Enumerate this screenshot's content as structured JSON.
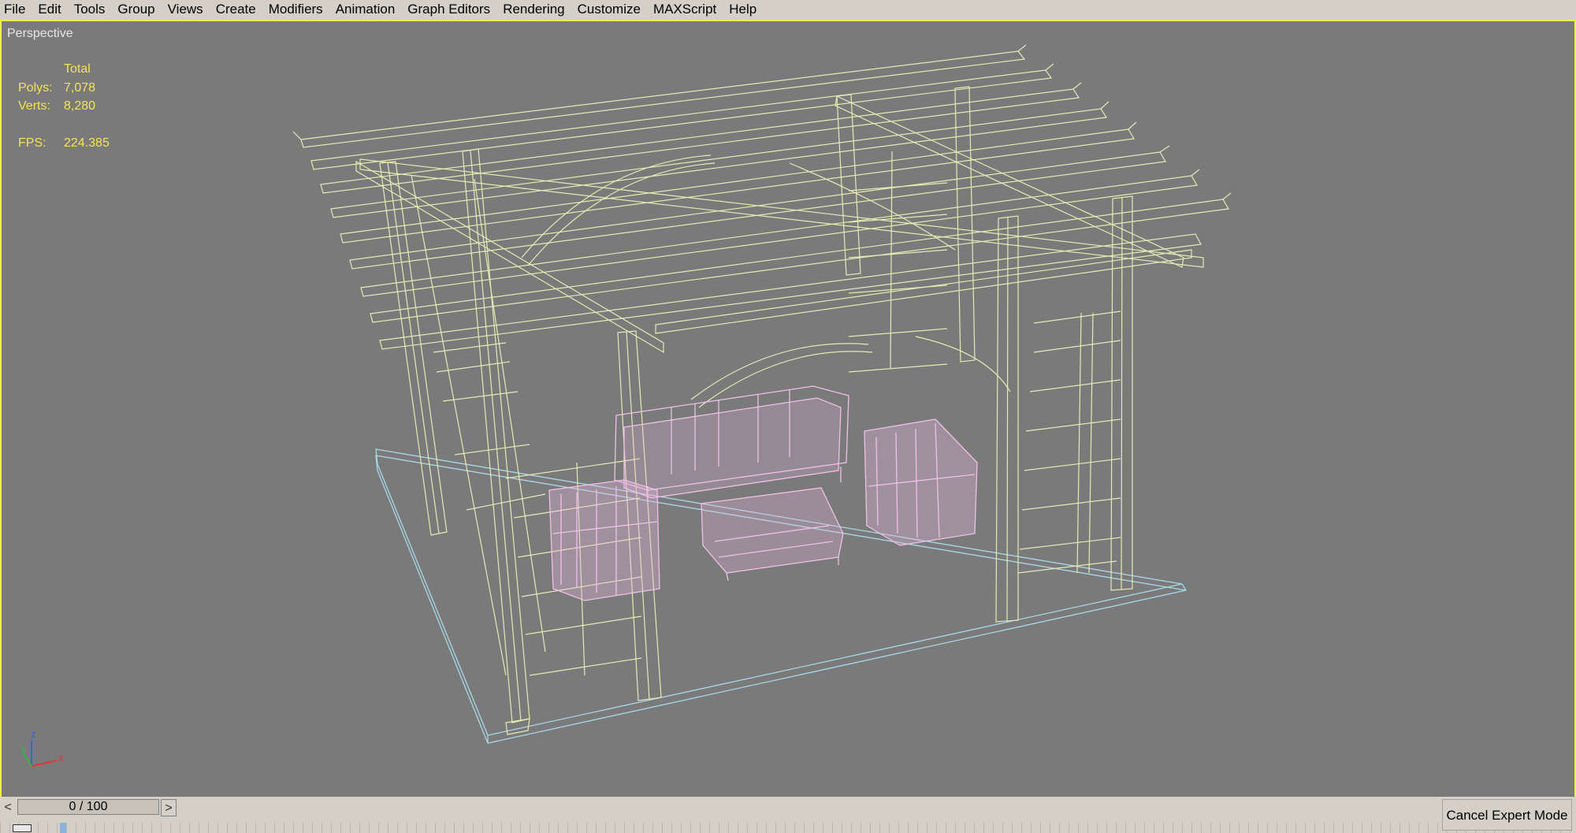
{
  "menu": [
    "File",
    "Edit",
    "Tools",
    "Group",
    "Views",
    "Create",
    "Modifiers",
    "Animation",
    "Graph Editors",
    "Rendering",
    "Customize",
    "MAXScript",
    "Help"
  ],
  "viewport": {
    "label": "Perspective",
    "stats": {
      "header": "Total",
      "polys_label": "Polys:",
      "polys_value": "7,078",
      "verts_label": "Verts:",
      "verts_value": "8,280",
      "fps_label": "FPS:",
      "fps_value": "224.385"
    },
    "gizmo": {
      "z": "z",
      "y": "y",
      "x": "x"
    },
    "colors": {
      "background": "#7a7a7a",
      "pergola": "#e6ebb4",
      "furniture": "#f0c0e8",
      "ground": "#a8d8e8",
      "border": "#f0f04a"
    }
  },
  "timeline": {
    "prev": "<",
    "next": ">",
    "slider_label": "0 / 100"
  },
  "status": {
    "cancel_expert": "Cancel Expert Mode"
  }
}
